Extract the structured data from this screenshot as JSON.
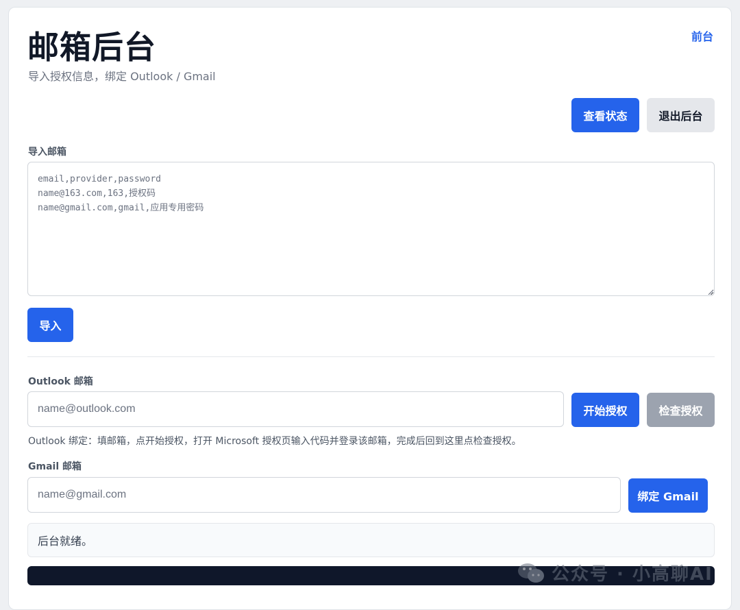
{
  "header": {
    "title": "邮箱后台",
    "subtitle": "导入授权信息，绑定 Outlook / Gmail",
    "front_link": "前台"
  },
  "toolbar": {
    "view_status_label": "查看状态",
    "logout_label": "退出后台"
  },
  "import": {
    "label": "导入邮箱",
    "placeholder": "email,provider,password\nname@163.com,163,授权码\nname@gmail.com,gmail,应用专用密码",
    "value": "",
    "import_button": "导入"
  },
  "outlook": {
    "label": "Outlook 邮箱",
    "placeholder": "name@outlook.com",
    "value": "",
    "start_auth_button": "开始授权",
    "check_auth_button": "检查授权",
    "hint": "Outlook 绑定：填邮箱，点开始授权，打开 Microsoft 授权页输入代码并登录该邮箱，完成后回到这里点检查授权。"
  },
  "gmail": {
    "label": "Gmail 邮箱",
    "placeholder": "name@gmail.com",
    "value": "",
    "bind_button": "绑定 Gmail"
  },
  "status": {
    "message": "后台就绪。"
  },
  "watermark": {
    "text": "公众号 · 小高聊AI",
    "icon": "wechat-icon"
  },
  "colors": {
    "primary": "#2563eb",
    "light_button": "#e5e7eb",
    "disabled_button": "#9ca3af",
    "log_background": "#0f172a"
  }
}
